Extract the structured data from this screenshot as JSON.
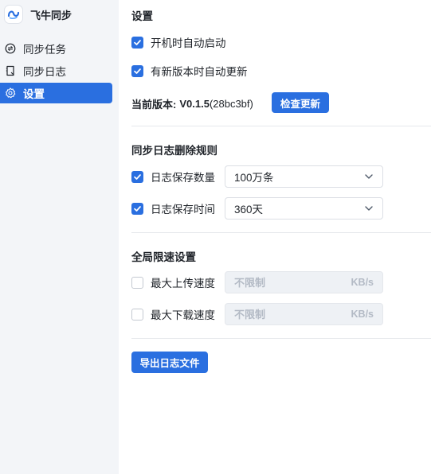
{
  "app": {
    "name": "飞牛同步"
  },
  "sidebar": {
    "items": [
      {
        "label": "同步任务",
        "icon": "sync-circle-icon"
      },
      {
        "label": "同步日志",
        "icon": "log-document-icon"
      },
      {
        "label": "设置",
        "icon": "gear-icon",
        "active": true
      }
    ]
  },
  "settings": {
    "title": "设置",
    "auto_start": {
      "label": "开机时自动启动",
      "checked": true
    },
    "auto_update": {
      "label": "有新版本时自动更新",
      "checked": true
    },
    "version": {
      "label": "当前版本:",
      "number": "V0.1.5",
      "hash": "(28bc3bf)"
    },
    "check_update_label": "检查更新"
  },
  "log_rules": {
    "title": "同步日志删除规则",
    "count": {
      "label": "日志保存数量",
      "checked": true,
      "value": "100万条"
    },
    "time": {
      "label": "日志保存时间",
      "checked": true,
      "value": "360天"
    }
  },
  "speed_limit": {
    "title": "全局限速设置",
    "upload": {
      "label": "最大上传速度",
      "checked": false,
      "placeholder": "不限制",
      "unit": "KB/s"
    },
    "download": {
      "label": "最大下载速度",
      "checked": false,
      "placeholder": "不限制",
      "unit": "KB/s"
    }
  },
  "export_label": "导出日志文件",
  "colors": {
    "accent": "#2a6fe0",
    "sidebar_bg": "#f3f5f8",
    "disabled_text": "#b3bac5"
  }
}
